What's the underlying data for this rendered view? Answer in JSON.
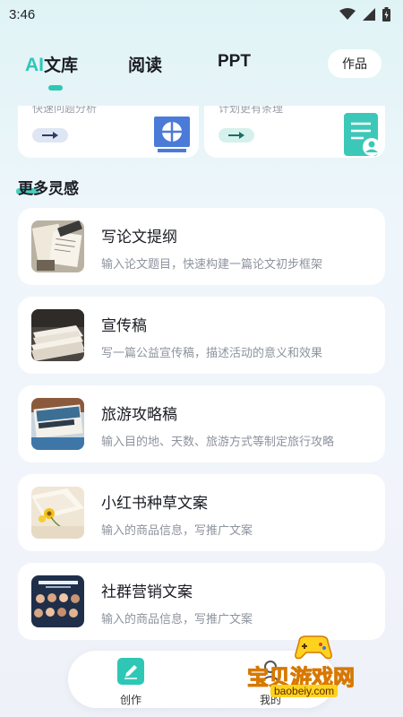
{
  "status_bar": {
    "time": "3:46",
    "icons": [
      "wifi-icon",
      "signal-icon",
      "battery-icon"
    ]
  },
  "header": {
    "tabs": [
      {
        "label_ai": "AI",
        "label_rest": "文库",
        "active": true
      },
      {
        "label": "阅读"
      },
      {
        "label": "PPT"
      }
    ],
    "works_button": "作品"
  },
  "top_cards": [
    {
      "desc": "快速问题分析",
      "icon": "presentation-icon",
      "accent": "#4a7bd8"
    },
    {
      "desc": "计划更有条理",
      "icon": "document-user-icon",
      "accent": "#3cc8b9"
    }
  ],
  "section_title": "更多灵感",
  "cards": [
    {
      "title": "写论文提纲",
      "desc": "输入论文题目，快速构建一篇论文初步框架"
    },
    {
      "title": "宣传稿",
      "desc": "写一篇公益宣传稿，描述活动的意义和效果"
    },
    {
      "title": "旅游攻略稿",
      "desc": "输入目的地、天数、旅游方式等制定旅行攻略"
    },
    {
      "title": "小红书种草文案",
      "desc": "输入的商品信息，写推广文案"
    },
    {
      "title": "社群营销文案",
      "desc": "输入的商品信息，写推广文案"
    }
  ],
  "bottom_nav": {
    "create": "创作",
    "mine": "我的"
  },
  "watermark": {
    "line1": "宝贝游戏网",
    "line2": "baobeiy.com"
  },
  "colors": {
    "accent": "#2ec7b6",
    "blue": "#4a7bd8"
  }
}
